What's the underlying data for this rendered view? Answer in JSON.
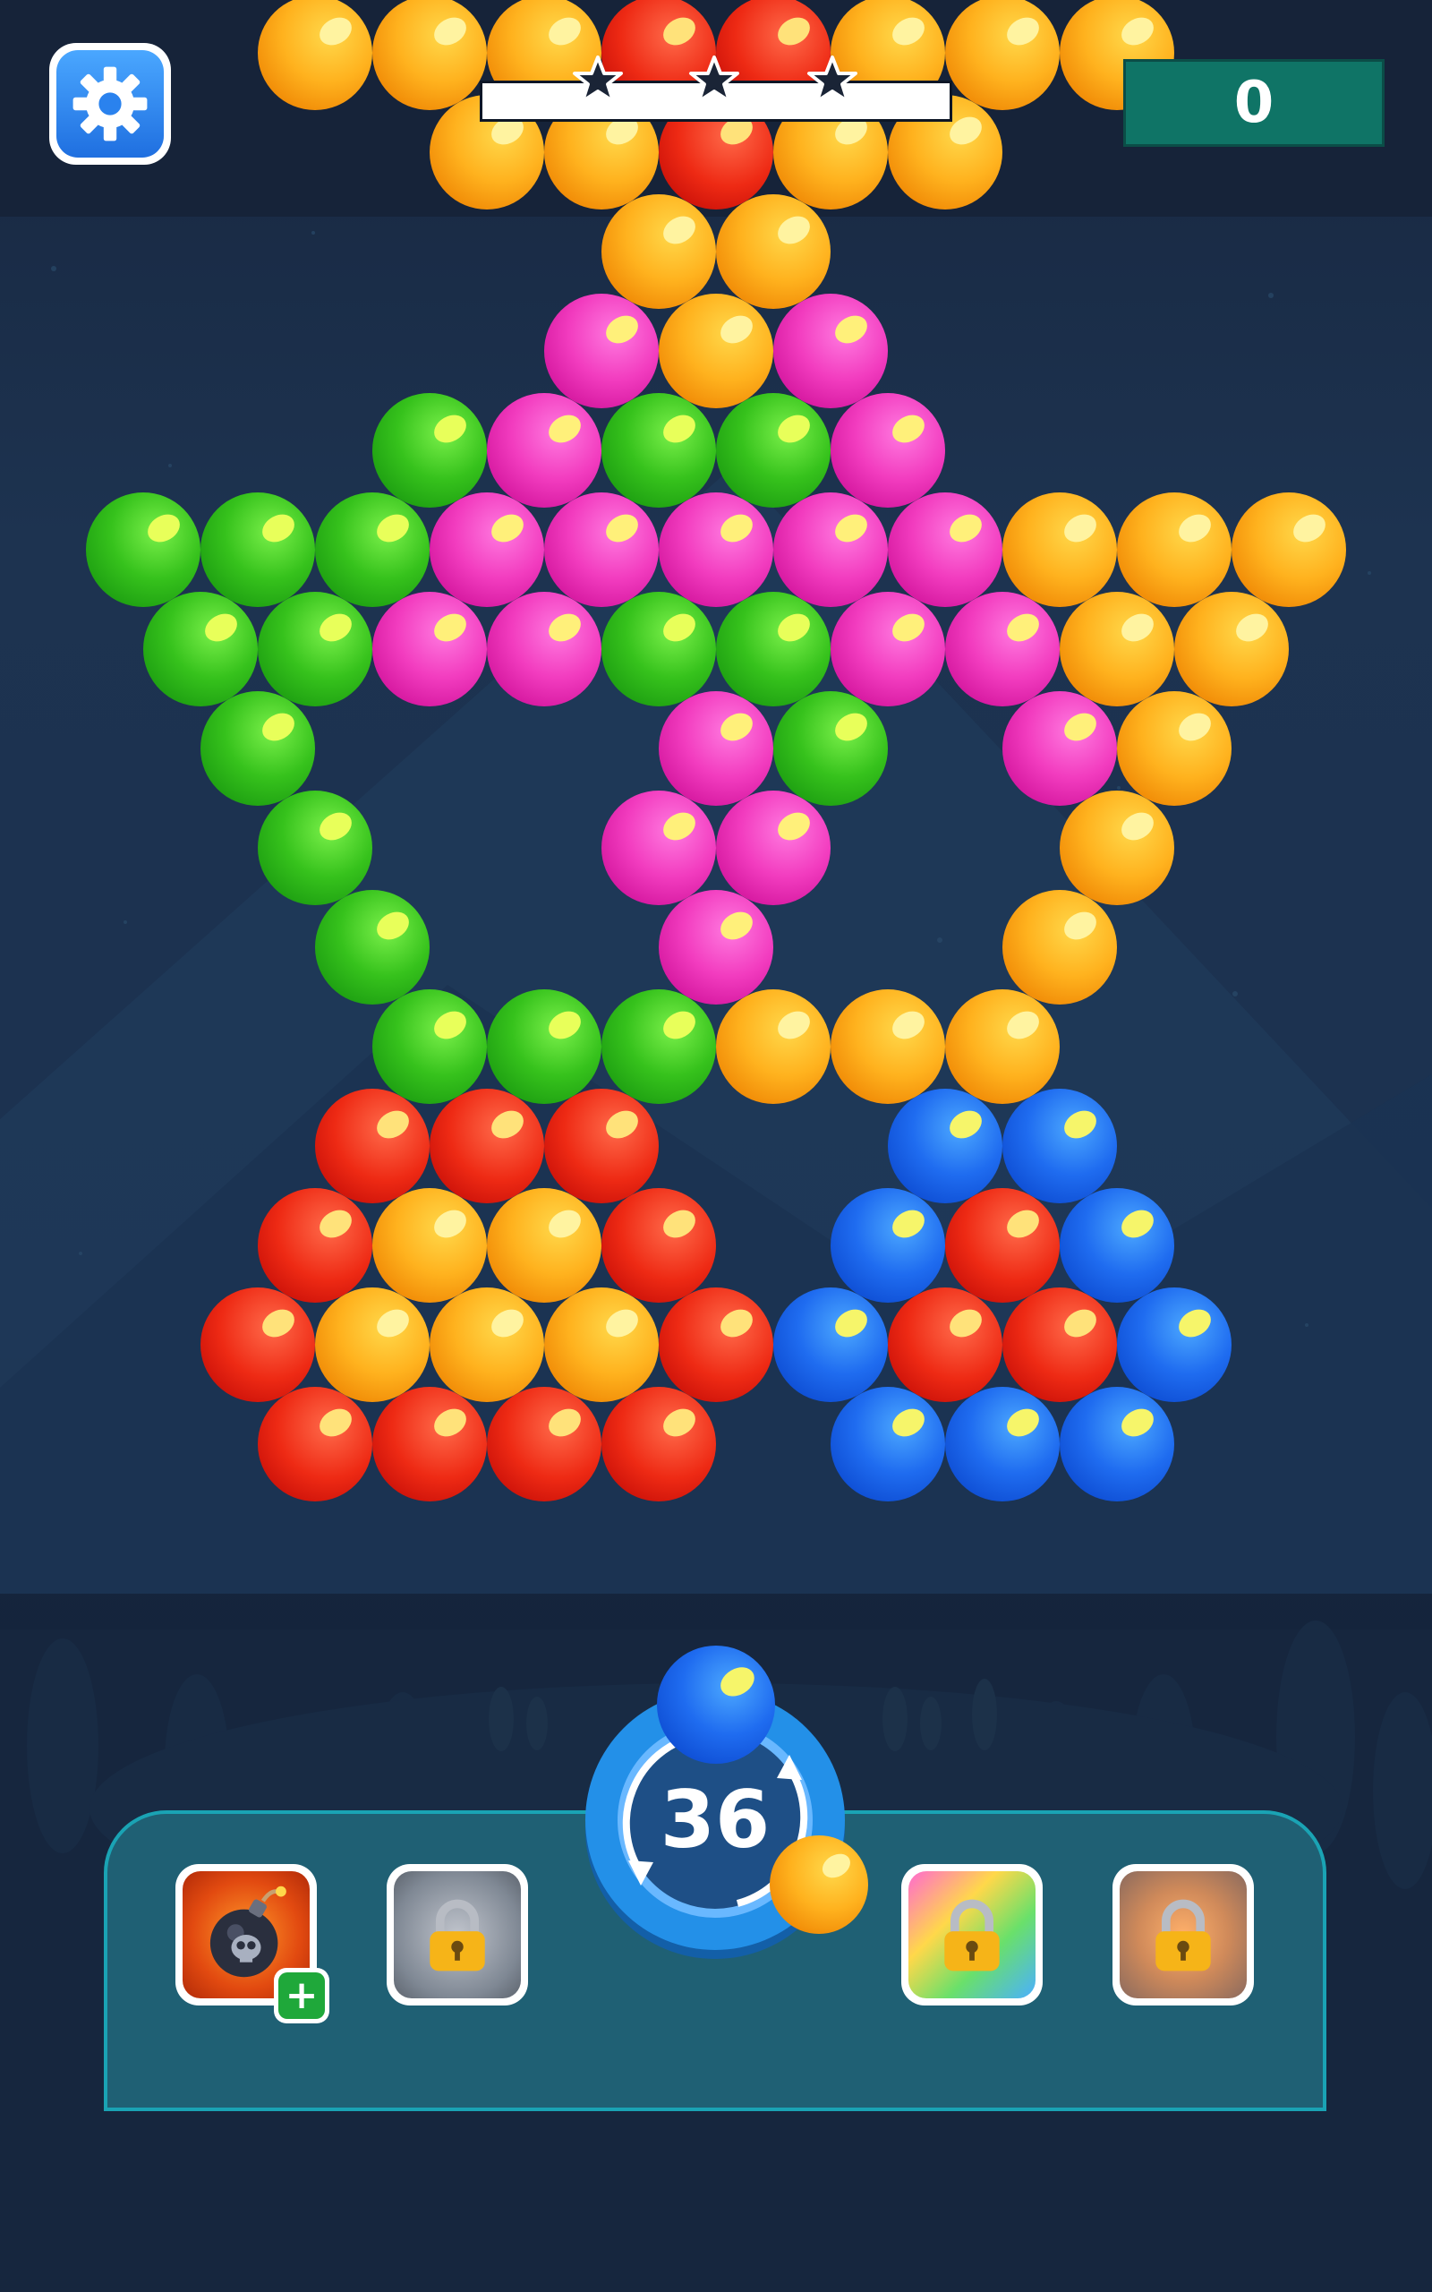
{
  "hud": {
    "score": "0",
    "stars_total": 3,
    "stars_earned": 0,
    "progress": 0
  },
  "board": {
    "colors": {
      "orange": "#ffb21e",
      "red": "#ee2a14",
      "green": "#36c21c",
      "pink": "#f23cbf",
      "blue": "#1f6cf0"
    },
    "rows": [
      [
        "orange",
        "orange",
        "orange",
        "red",
        "red",
        "orange",
        "orange",
        "orange"
      ],
      [
        "orange",
        "orange",
        "red",
        "orange",
        "orange"
      ],
      [
        "orange",
        "orange"
      ],
      [
        "pink",
        "orange",
        "pink"
      ],
      [
        "green",
        "pink",
        "green",
        "green",
        "pink"
      ],
      [
        "green",
        "green",
        "green",
        "pink",
        "pink",
        "pink",
        "pink",
        "pink",
        "orange",
        "orange",
        "orange"
      ],
      [
        "green",
        "green",
        "pink",
        "pink",
        "green",
        "green",
        "pink",
        "pink",
        "orange",
        "orange"
      ],
      [
        "green",
        "pink",
        "green",
        "pink",
        "orange"
      ],
      [
        "green",
        "pink",
        "pink",
        "orange"
      ],
      [
        "green",
        "pink",
        "orange"
      ],
      [
        "green",
        "green",
        "green",
        "orange",
        "orange",
        "orange"
      ],
      [
        "red",
        "red",
        "red",
        "blue",
        "blue"
      ],
      [
        "red",
        "orange",
        "orange",
        "red",
        "blue",
        "red",
        "blue"
      ],
      [
        "red",
        "orange",
        "orange",
        "orange",
        "red",
        "blue",
        "red",
        "red",
        "blue"
      ],
      [
        "red",
        "red",
        "red",
        "red",
        "blue",
        "blue",
        "blue"
      ]
    ]
  },
  "shooter": {
    "moves_left": "36",
    "current_bubble": "blue",
    "next_bubble": "orange"
  },
  "powerups": [
    {
      "name": "bomb",
      "locked": false,
      "has_add": true
    },
    {
      "name": "locked-slot-2",
      "locked": true
    },
    {
      "name": "locked-slot-3",
      "locked": true
    },
    {
      "name": "locked-slot-4",
      "locked": true
    }
  ]
}
